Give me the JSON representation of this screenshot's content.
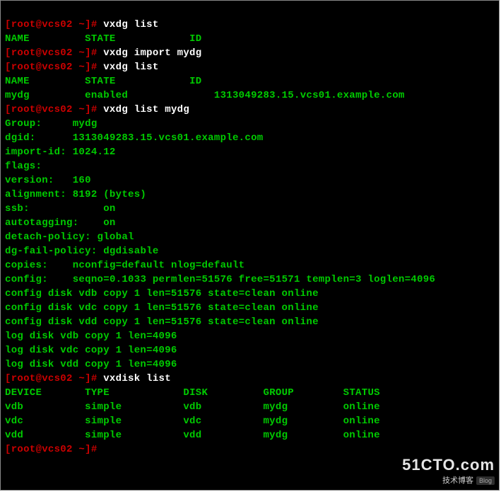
{
  "prompt": "[root@vcs02 ~]#",
  "cmd": {
    "vxdg_list": "vxdg list",
    "vxdg_import": "vxdg import mydg",
    "vxdg_list_mydg": "vxdg list mydg",
    "vxdisk_list": "vxdisk list"
  },
  "dg_header": {
    "name": "NAME",
    "state": "STATE",
    "id": "ID"
  },
  "dg_row": {
    "name": "mydg",
    "state": "enabled",
    "id": "1313049283.15.vcs01.example.com"
  },
  "detail": {
    "group_l": "Group:",
    "group_v": "mydg",
    "dgid_l": "dgid:",
    "dgid_v": "1313049283.15.vcs01.example.com",
    "import_l": "import-id:",
    "import_v": "1024.12",
    "flags_l": "flags:",
    "version_l": "version:",
    "version_v": "160",
    "align_l": "alignment:",
    "align_v": "8192 (bytes)",
    "ssb_l": "ssb:",
    "ssb_v": "on",
    "autotag_l": "autotagging:",
    "autotag_v": "on",
    "detach_l": "detach-policy:",
    "detach_v": "global",
    "dgfail_l": "dg-fail-policy:",
    "dgfail_v": "dgdisable",
    "copies_l": "copies:",
    "copies_v": "nconfig=default nlog=default",
    "config_l": "config:",
    "config_v": "seqno=0.1033 permlen=51576 free=51571 templen=3 loglen=4096",
    "cfg_vdb": "config disk vdb copy 1 len=51576 state=clean online",
    "cfg_vdc": "config disk vdc copy 1 len=51576 state=clean online",
    "cfg_vdd": "config disk vdd copy 1 len=51576 state=clean online",
    "log_vdb": "log disk vdb copy 1 len=4096",
    "log_vdc": "log disk vdc copy 1 len=4096",
    "log_vdd": "log disk vdd copy 1 len=4096"
  },
  "disk_header": {
    "device": "DEVICE",
    "type": "TYPE",
    "disk": "DISK",
    "group": "GROUP",
    "status": "STATUS"
  },
  "disk_rows": {
    "r0": {
      "device": "vdb",
      "type": "simple",
      "disk": "vdb",
      "group": "mydg",
      "status": "online"
    },
    "r1": {
      "device": "vdc",
      "type": "simple",
      "disk": "vdc",
      "group": "mydg",
      "status": "online"
    },
    "r2": {
      "device": "vdd",
      "type": "simple",
      "disk": "vdd",
      "group": "mydg",
      "status": "online"
    }
  },
  "watermark": {
    "main": "51CTO.com",
    "sub": "技术博客",
    "tag": "Blog"
  }
}
